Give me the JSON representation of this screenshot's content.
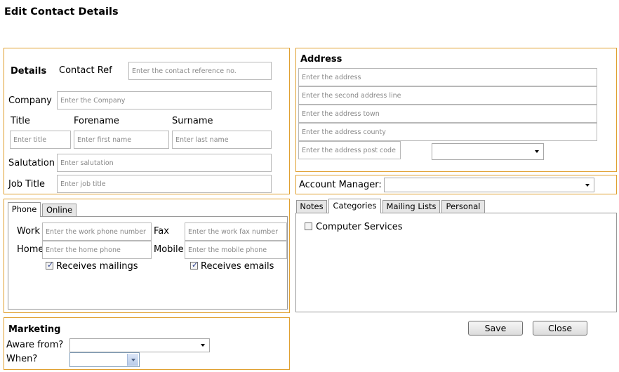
{
  "page": {
    "title": "Edit Contact Details"
  },
  "details": {
    "heading": "Details",
    "contact_ref_label": "Contact Ref",
    "contact_ref_placeholder": "Enter the contact reference no.",
    "company_label": "Company",
    "company_placeholder": "Enter the Company",
    "title_label": "Title",
    "forename_label": "Forename",
    "surname_label": "Surname",
    "title_placeholder": "Enter title",
    "forename_placeholder": "Enter first name",
    "surname_placeholder": "Enter last name",
    "salutation_label": "Salutation",
    "salutation_placeholder": "Enter salutation",
    "job_title_label": "Job Title",
    "job_title_placeholder": "Enter job title"
  },
  "address": {
    "heading": "Address",
    "line1_placeholder": "Enter the address",
    "line2_placeholder": "Enter the second address line",
    "town_placeholder": "Enter the address town",
    "county_placeholder": "Enter the address county",
    "postcode_placeholder": "Enter the address post code",
    "country_value": ""
  },
  "account_manager": {
    "label": "Account Manager:",
    "value": ""
  },
  "contact_tabs": {
    "tabs": [
      {
        "label": "Phone",
        "active": true
      },
      {
        "label": "Online",
        "active": false
      }
    ],
    "work_label": "Work",
    "work_placeholder": "Enter the work phone number",
    "fax_label": "Fax",
    "fax_placeholder": "Enter the work fax number",
    "home_label": "Home",
    "home_placeholder": "Enter the home phone",
    "mobile_label": "Mobile",
    "mobile_placeholder": "Enter the mobile phone",
    "receives_mailings_label": "Receives mailings",
    "receives_mailings_checked": true,
    "receives_emails_label": "Receives emails",
    "receives_emails_checked": true
  },
  "info_tabs": {
    "tabs": [
      {
        "label": "Notes",
        "active": false
      },
      {
        "label": "Categories",
        "active": true
      },
      {
        "label": "Mailing Lists",
        "active": false
      },
      {
        "label": "Personal",
        "active": false
      }
    ],
    "categories": [
      {
        "label": "Computer Services",
        "checked": false
      }
    ]
  },
  "marketing": {
    "heading": "Marketing",
    "aware_from_label": "Aware from?",
    "aware_from_value": "",
    "when_label": "When?",
    "when_value": ""
  },
  "actions": {
    "save_label": "Save",
    "close_label": "Close"
  },
  "colors": {
    "panel_border": "#e0a030",
    "checkbox_tick": "#2a3f8f"
  }
}
